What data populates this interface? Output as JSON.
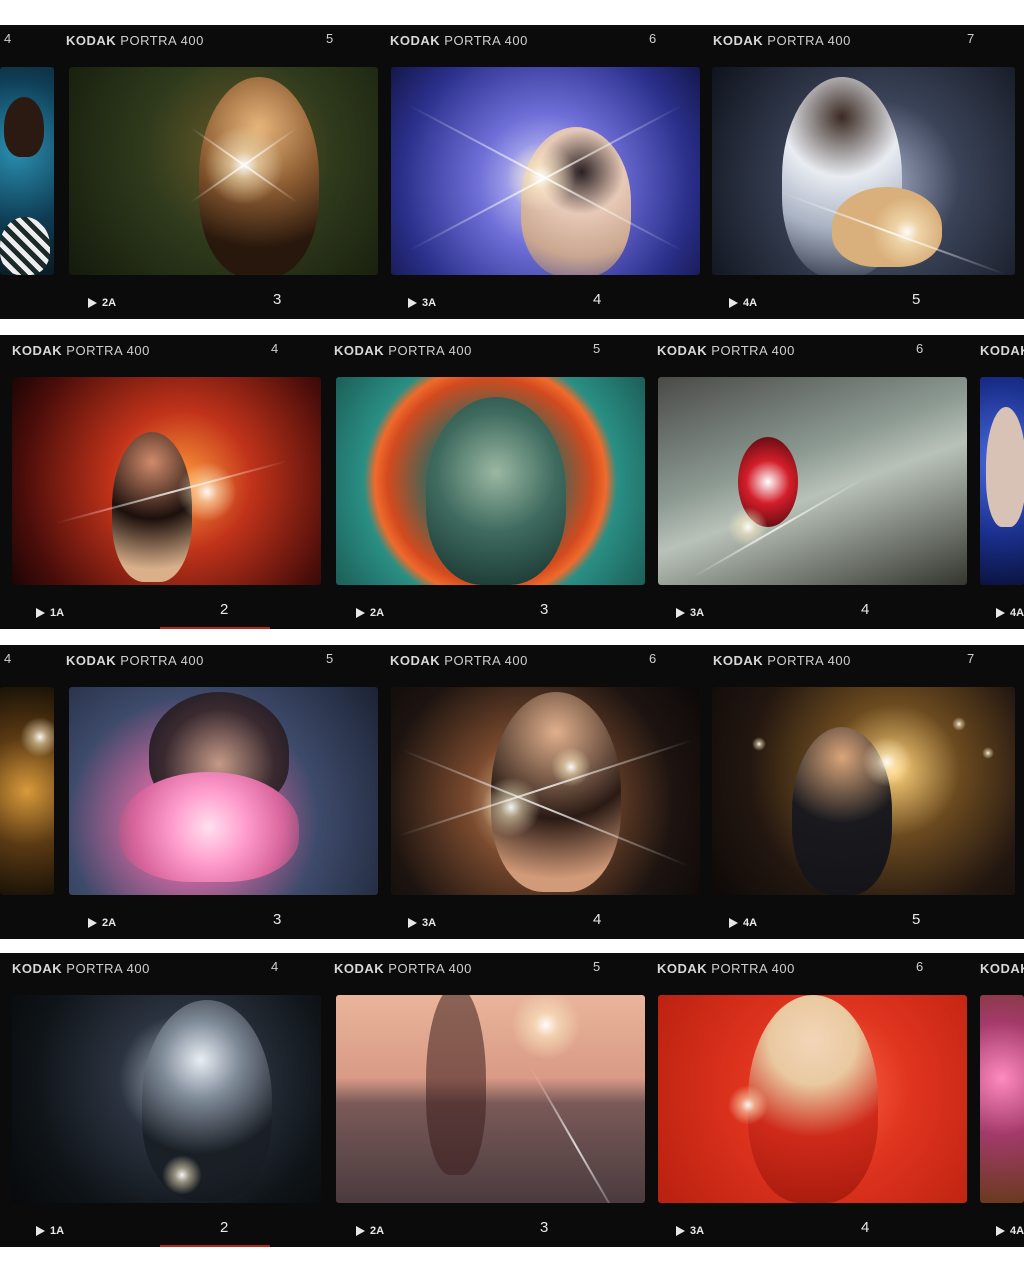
{
  "film": {
    "brand_bold": "KODAK",
    "brand_stock": "PORTRA 400"
  },
  "strips": [
    {
      "edge_numbers": [
        "4",
        "5",
        "6",
        "7"
      ],
      "frame_codes": [
        "2A",
        "3A",
        "4A"
      ],
      "big_numbers": [
        "3",
        "4",
        "5"
      ],
      "photos": [
        "poolside",
        "lighter-portrait",
        "singer-blue-light",
        "guitarist-night"
      ]
    },
    {
      "edge_numbers": [
        "4",
        "5",
        "6"
      ],
      "frame_codes": [
        "1A",
        "2A",
        "3A",
        "4A"
      ],
      "big_numbers": [
        "2",
        "3",
        "4"
      ],
      "photos": [
        "singer-red-stage",
        "halo-portrait",
        "vintage-car-tail",
        "blue-portrait"
      ]
    },
    {
      "edge_numbers": [
        "4",
        "5",
        "6",
        "7"
      ],
      "frame_codes": [
        "2A",
        "3A",
        "4A"
      ],
      "big_numbers": [
        "3",
        "4",
        "5"
      ],
      "photos": [
        "torch-left",
        "flower-bouquet",
        "guitar-sparkle",
        "singer-candles"
      ]
    },
    {
      "edge_numbers": [
        "4",
        "5",
        "6"
      ],
      "frame_codes": [
        "1A",
        "2A",
        "3A",
        "4A"
      ],
      "big_numbers": [
        "2",
        "3",
        "4"
      ],
      "photos": [
        "shadow-portrait",
        "sunset-sea",
        "red-telephone",
        "pink-flowers-car"
      ]
    }
  ],
  "colors": {
    "film_base": "#0b0b0b",
    "edge_text": "#cfcfcf",
    "accent_red": "#b5261e"
  }
}
